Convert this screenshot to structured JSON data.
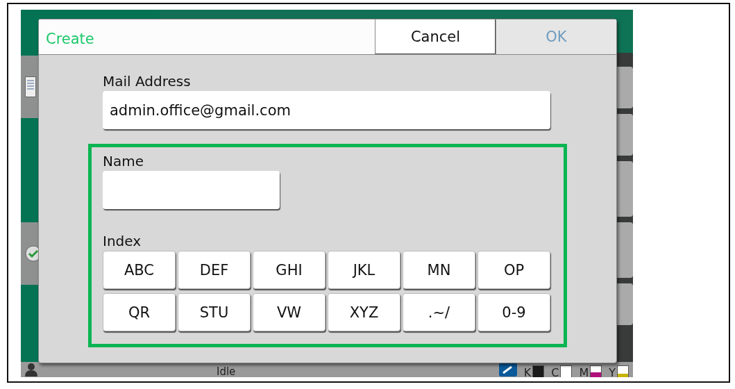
{
  "dialog": {
    "title": "Create",
    "buttons": [
      {
        "label": "Cancel",
        "disabled": false
      },
      {
        "label": "OK",
        "disabled": true
      }
    ],
    "mail_address": {
      "label": "Mail Address",
      "value": "admin.office@gmail.com"
    },
    "name": {
      "label": "Name"
    },
    "index": {
      "label": "Index",
      "keys": [
        "ABC",
        "DEF",
        "GHI",
        "JKL",
        "MN",
        "OP",
        "QR",
        "STU",
        "VW",
        "XYZ",
        ".~/",
        "0-9"
      ]
    }
  },
  "status_bar": {
    "status": "Idle",
    "inks": [
      {
        "label": "K",
        "color": "#1a1a1a",
        "level": 1
      },
      {
        "label": "C"
      },
      {
        "label": "M",
        "color": "#b0107a",
        "level": 0.5
      },
      {
        "label": "Y",
        "color": "#c8b400",
        "level": 0.35
      }
    ]
  }
}
